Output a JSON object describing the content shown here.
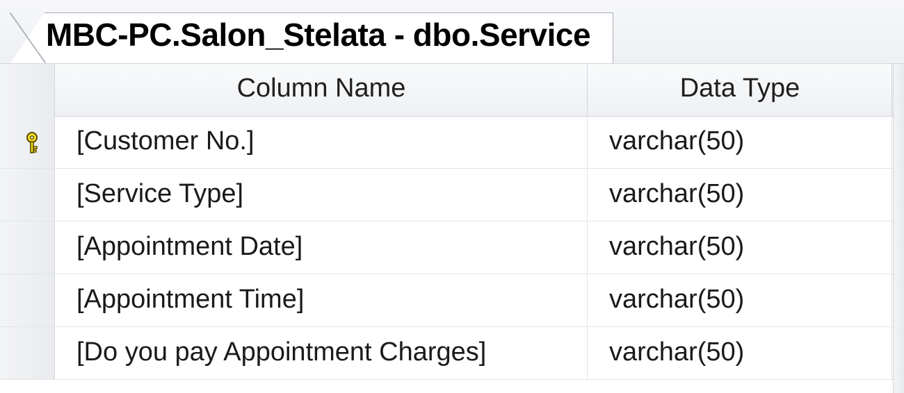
{
  "tab": {
    "title": "MBC-PC.Salon_Stelata - dbo.Service"
  },
  "grid": {
    "headers": {
      "column_name": "Column Name",
      "data_type": "Data Type"
    },
    "rows": [
      {
        "column_name": "[Customer No.]",
        "data_type": "varchar(50)",
        "primary_key": true
      },
      {
        "column_name": "[Service Type]",
        "data_type": "varchar(50)",
        "primary_key": false
      },
      {
        "column_name": "[Appointment Date]",
        "data_type": "varchar(50)",
        "primary_key": false
      },
      {
        "column_name": "[Appointment Time]",
        "data_type": "varchar(50)",
        "primary_key": false
      },
      {
        "column_name": "[Do you pay Appointment Charges]",
        "data_type": "varchar(50)",
        "primary_key": false
      }
    ]
  },
  "icons": {
    "primary_key": "key-icon"
  },
  "colors": {
    "key_fill": "#f2e21a",
    "key_stroke": "#5a4a00"
  }
}
